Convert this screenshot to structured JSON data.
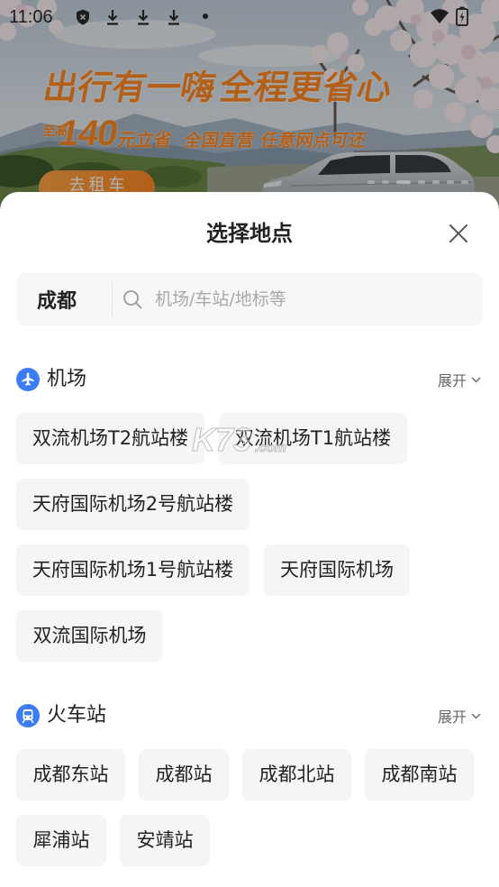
{
  "status_bar": {
    "time": "11:06",
    "left_icons": [
      "shield-icon",
      "download-icon",
      "download-icon",
      "download-icon",
      "notification-dot-icon"
    ],
    "right_icons": [
      "wifi-icon",
      "battery-icon"
    ]
  },
  "banner": {
    "headline_left": "出行有一嗨",
    "headline_right": "全程更省心",
    "prefix": "至高",
    "amount": "140",
    "unit": "元立省",
    "tagline": "全国直营 任意网点可还",
    "cta_label": "去租车",
    "carousel": {
      "count": 7,
      "active_index": 2
    }
  },
  "sheet": {
    "title": "选择地点",
    "close_icon": "close-icon"
  },
  "search": {
    "city": "成都",
    "placeholder": "机场/车站/地标等",
    "icon": "search-icon"
  },
  "sections": [
    {
      "icon": "airplane-icon",
      "title": "机场",
      "expand_label": "展开",
      "items": [
        "双流机场T2航站楼",
        "双流机场T1航站楼",
        "天府国际机场2号航站楼",
        "天府国际机场1号航站楼",
        "天府国际机场",
        "双流国际机场"
      ]
    },
    {
      "icon": "train-icon",
      "title": "火车站",
      "expand_label": "展开",
      "items": [
        "成都东站",
        "成都站",
        "成都北站",
        "成都南站",
        "犀浦站",
        "安靖站"
      ]
    }
  ],
  "watermark": {
    "brand": "K73",
    "suffix": ".com"
  },
  "colors": {
    "accent": "#3c7cf4",
    "brand_orange": "#ff8a25",
    "chip_bg": "#f5f5f5",
    "text_primary": "#222222",
    "text_secondary": "#666666",
    "placeholder": "#a9a9a9",
    "search_bg": "#f6f7f8"
  }
}
